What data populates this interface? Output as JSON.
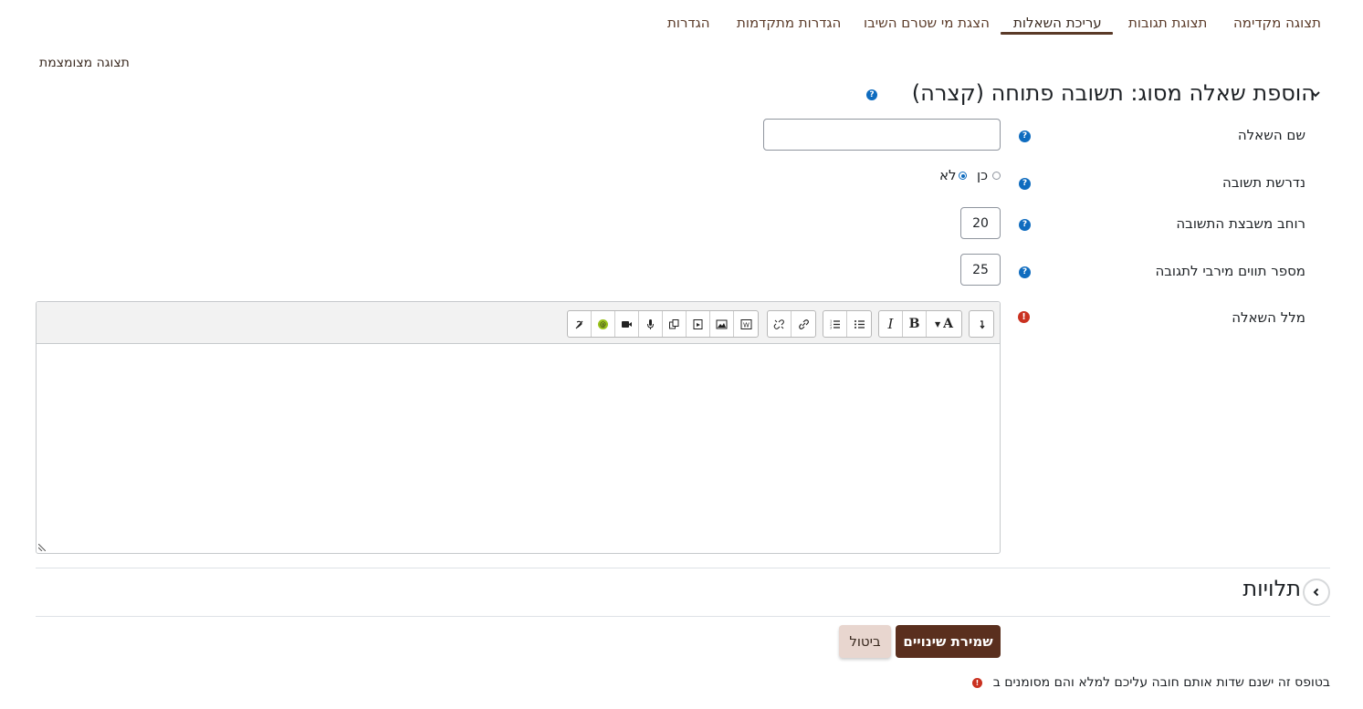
{
  "tabs": [
    {
      "label": "תצוגה מקדימה"
    },
    {
      "label": "תצוגת תגובות"
    },
    {
      "label": "עריכת השאלות",
      "active": true
    },
    {
      "label": "הצגת מי שטרם השיבו"
    },
    {
      "label": "הגדרות מתקדמות"
    },
    {
      "label": "הגדרות"
    }
  ],
  "compact_view": "תצוגה מצומצמת",
  "section": {
    "title": "הוספת שאלה מסוג: תשובה פתוחה (קצרה)"
  },
  "fields": {
    "question_name": {
      "label": "שם השאלה",
      "value": ""
    },
    "required": {
      "label": "נדרשת תשובה",
      "option_yes": "כן",
      "option_no": "לא",
      "selected": "לא"
    },
    "answer_width": {
      "label": "רוחב משבצת התשובה",
      "value": "20"
    },
    "max_chars": {
      "label": "מספר תווים מירבי לתגובה",
      "value": "25"
    },
    "question_text": {
      "label": "מלל השאלה"
    }
  },
  "editor_toolbar": {
    "groups": [
      [
        "undo-icon"
      ],
      [
        "font-color-icon",
        "bold-icon",
        "italic-icon"
      ],
      [
        "unordered-list-icon",
        "ordered-list-icon"
      ],
      [
        "link-icon",
        "unlink-icon"
      ],
      [
        "wiris-icon",
        "image-icon",
        "media-icon",
        "manage-files-icon",
        "record-audio-icon",
        "record-video-icon",
        "h5p-icon",
        "accessibility-checker-icon"
      ]
    ],
    "bold_glyph": "B",
    "italic_glyph": "I",
    "font_glyph": "A"
  },
  "dependencies": {
    "title": "תלויות"
  },
  "buttons": {
    "save": "שמירת שינויים",
    "cancel": "ביטול"
  },
  "footnote": "בטופס זה ישנם שדות אותם חובה עליכם למלא והם מסומנים ב",
  "colors": {
    "brand": "#5a2f1e",
    "help": "#0f6cbf",
    "required": "#ca3120"
  }
}
